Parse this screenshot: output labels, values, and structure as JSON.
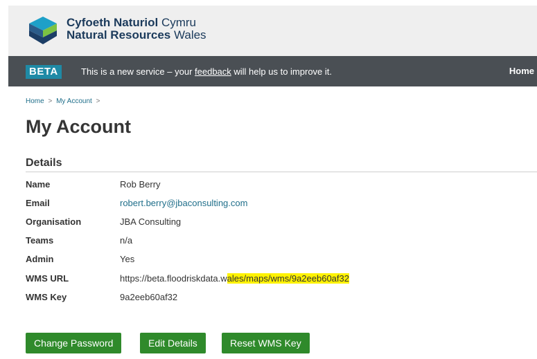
{
  "header": {
    "org_bold_welsh": "Cyfoeth Naturiol",
    "org_light_welsh": " Cymru",
    "org_bold_english": "Natural Resources",
    "org_light_english": " Wales",
    "logo_colors": {
      "top": "#1ea0c8",
      "left": "#2b5c8a",
      "right": "#7cc243",
      "bottom": "#1c3e66"
    }
  },
  "beta_banner": {
    "tag": "BETA",
    "message_before": "This is a new service – your ",
    "feedback_link": "feedback",
    "message_after": " will help us to improve it.",
    "home_link": "Home"
  },
  "breadcrumb": {
    "home": "Home",
    "current": "My Account",
    "separator": ">"
  },
  "page_title": "My Account",
  "details": {
    "heading": "Details",
    "rows": [
      {
        "label": "Name",
        "value": "Rob Berry"
      },
      {
        "label": "Email",
        "value": "robert.berry@jbaconsulting.com"
      },
      {
        "label": "Organisation",
        "value": "JBA Consulting"
      },
      {
        "label": "Teams",
        "value": "n/a"
      },
      {
        "label": "Admin",
        "value": "Yes"
      },
      {
        "label": "WMS URL",
        "value_plain": "https://beta.floodriskdata.w",
        "value_highlighted": "ales/maps/wms/9a2eeb60af32"
      },
      {
        "label": "WMS Key",
        "value": "9a2eeb60af32"
      }
    ]
  },
  "actions": {
    "change_password": "Change Password",
    "edit_details": "Edit Details",
    "reset_wms_key": "Reset WMS Key"
  },
  "colors": {
    "button_green": "#2f8a2b",
    "beta_bar": "#4a4f54",
    "beta_tag": "#1f8aa6",
    "link": "#1f6e8a",
    "highlight": "#fff200"
  }
}
